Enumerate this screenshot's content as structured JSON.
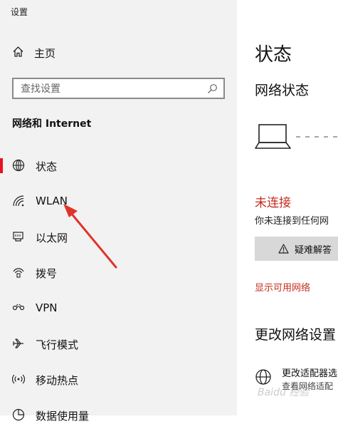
{
  "app": {
    "title": "设置"
  },
  "sidebar": {
    "home_label": "主页",
    "search_placeholder": "查找设置",
    "section_title": "网络和 Internet",
    "items": [
      {
        "label": "状态",
        "icon": "globe-icon",
        "selected": true
      },
      {
        "label": "WLAN",
        "icon": "wifi-icon",
        "selected": false
      },
      {
        "label": "以太网",
        "icon": "ethernet-icon",
        "selected": false
      },
      {
        "label": "拨号",
        "icon": "dialup-icon",
        "selected": false
      },
      {
        "label": "VPN",
        "icon": "vpn-icon",
        "selected": false
      },
      {
        "label": "飞行模式",
        "icon": "airplane-icon",
        "selected": false
      },
      {
        "label": "移动热点",
        "icon": "hotspot-icon",
        "selected": false
      },
      {
        "label": "数据使用量",
        "icon": "data-usage-icon",
        "selected": false
      }
    ]
  },
  "main": {
    "heading": "状态",
    "network_status": "网络状态",
    "status_text": "未连接",
    "status_desc": "你未连接到任何网",
    "troubleshoot_label": "疑难解答",
    "show_networks_link": "显示可用网络",
    "change_heading": "更改网络设置",
    "adapter": {
      "title": "更改适配器选",
      "desc": "查看网络适配"
    }
  },
  "watermark": "Baidu 经验",
  "colors": {
    "sidebar_bg": "#f2f2f2",
    "accent_red": "#e81123",
    "error_red": "#c42b1c",
    "annotation_arrow": "#e0332b"
  }
}
